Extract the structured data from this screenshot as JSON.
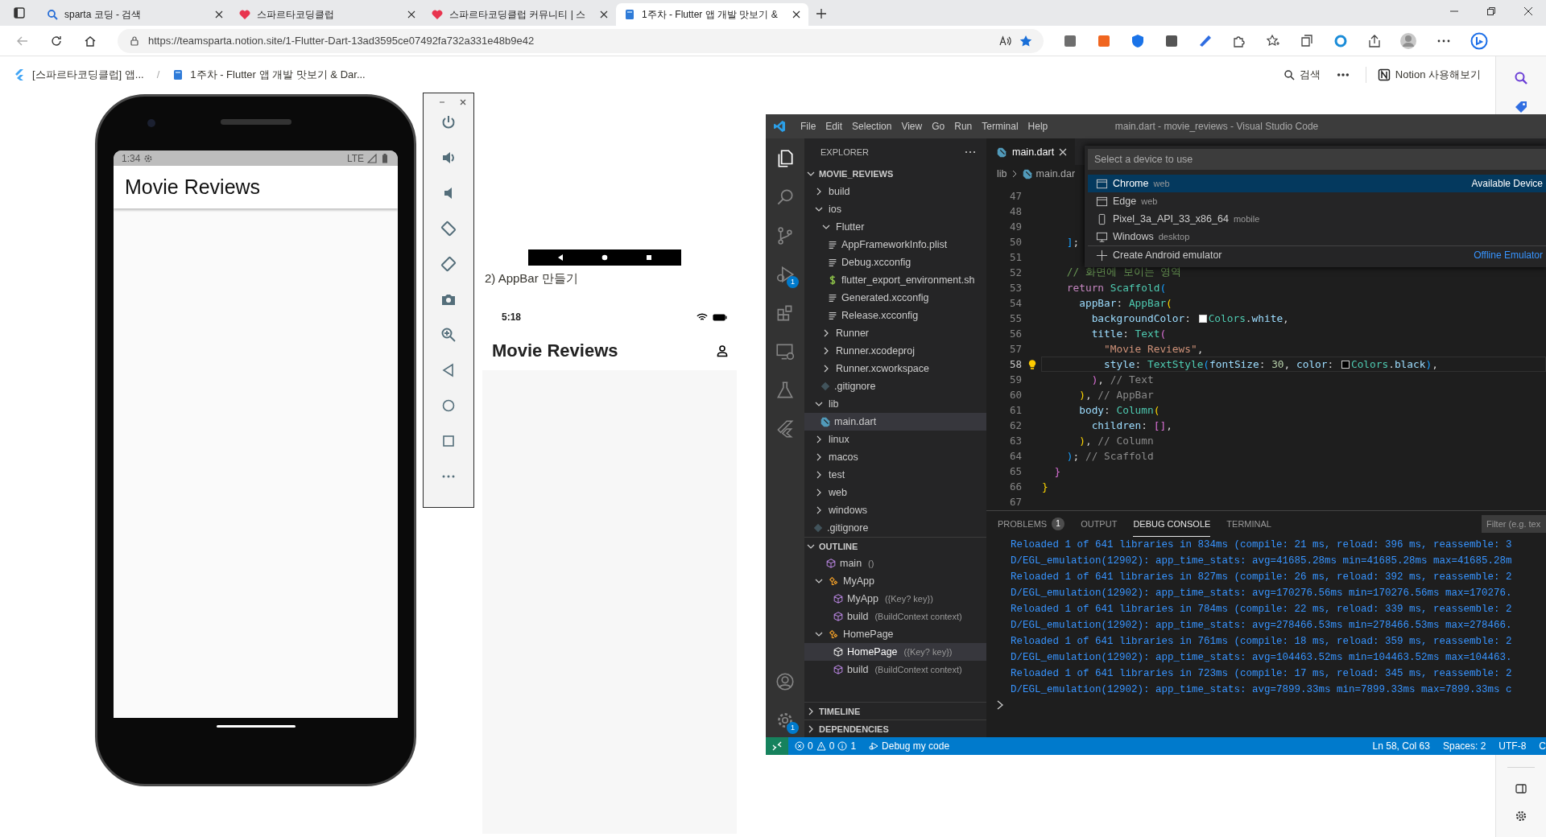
{
  "browser": {
    "tabs": [
      {
        "title": "sparta 코딩 - 검색",
        "selected": false
      },
      {
        "title": "스파르타코딩클럽",
        "selected": false
      },
      {
        "title": "스파르타코딩클럽 커뮤니티 | 스",
        "selected": false
      },
      {
        "title": "1주차 - Flutter 앱 개발 맛보기 &",
        "selected": true
      }
    ],
    "address": "https://teamsparta.notion.site/1-Flutter-Dart-13ad3595ce07492fa732a331e48b9e42"
  },
  "notion": {
    "breadcrumb": [
      {
        "text": "[스파르타코딩클럽] 앱...",
        "kind": "app"
      },
      {
        "text": "/",
        "kind": "sep"
      },
      {
        "text": "1주차 - Flutter 앱 개발 맛보기 & Dar...",
        "kind": "page"
      }
    ],
    "search": "검색",
    "try_button": "Notion 사용해보기"
  },
  "emulator": {
    "time": "1:34",
    "network": "LTE",
    "app_title": "Movie Reviews"
  },
  "note": "2) AppBar 만들기",
  "ios_shot": {
    "time": "5:18",
    "app_title": "Movie Reviews"
  },
  "vscode": {
    "menu": [
      "File",
      "Edit",
      "Selection",
      "View",
      "Go",
      "Run",
      "Terminal",
      "Help"
    ],
    "title": "main.dart - movie_reviews - Visual Studio Code",
    "badges": {
      "debug": "1",
      "settings": "1"
    },
    "explorer": {
      "header": "EXPLORER",
      "root": {
        "name": "MOVIE_REVIEWS",
        "expanded": true,
        "children": [
          {
            "name": "build",
            "kind": "folder",
            "expanded": false,
            "selected": false
          },
          {
            "name": "ios",
            "kind": "folder",
            "expanded": true,
            "selected": false,
            "children": [
              {
                "name": "Flutter",
                "kind": "folder",
                "expanded": true,
                "selected": false,
                "children": [
                  {
                    "name": "AppFrameworkInfo.plist",
                    "kind": "file",
                    "selected": false
                  },
                  {
                    "name": "Debug.xcconfig",
                    "kind": "file",
                    "selected": false
                  },
                  {
                    "name": "flutter_export_environment.sh",
                    "kind": "shell",
                    "selected": false
                  },
                  {
                    "name": "Generated.xcconfig",
                    "kind": "file",
                    "selected": false
                  },
                  {
                    "name": "Release.xcconfig",
                    "kind": "file",
                    "selected": false
                  }
                ]
              },
              {
                "name": "Runner",
                "kind": "folder",
                "expanded": false,
                "selected": false
              },
              {
                "name": "Runner.xcodeproj",
                "kind": "folder",
                "expanded": false,
                "selected": false
              },
              {
                "name": "Runner.xcworkspace",
                "kind": "folder",
                "expanded": false,
                "selected": false
              },
              {
                "name": ".gitignore",
                "kind": "git",
                "selected": false
              }
            ]
          },
          {
            "name": "lib",
            "kind": "folder",
            "expanded": true,
            "selected": false,
            "children": [
              {
                "name": "main.dart",
                "kind": "dart",
                "selected": true
              }
            ]
          },
          {
            "name": "linux",
            "kind": "folder",
            "expanded": false,
            "selected": false
          },
          {
            "name": "macos",
            "kind": "folder",
            "expanded": false,
            "selected": false
          },
          {
            "name": "test",
            "kind": "folder",
            "expanded": false,
            "selected": false
          },
          {
            "name": "web",
            "kind": "folder",
            "expanded": false,
            "selected": false
          },
          {
            "name": "windows",
            "kind": "folder",
            "expanded": false,
            "selected": false
          },
          {
            "name": ".gitignore",
            "kind": "git",
            "selected": false
          }
        ]
      }
    },
    "outline": {
      "title": "OUTLINE",
      "expanded": true,
      "children": [
        {
          "name": "main",
          "detail": "()",
          "kind": "method",
          "selected": false
        },
        {
          "name": "MyApp",
          "kind": "class",
          "expanded": true,
          "selected": false,
          "children": [
            {
              "name": "MyApp",
              "detail": "({Key? key})",
              "kind": "method",
              "selected": false
            },
            {
              "name": "build",
              "detail": "(BuildContext context)",
              "kind": "method",
              "selected": false
            }
          ]
        },
        {
          "name": "HomePage",
          "kind": "class",
          "expanded": true,
          "selected": false,
          "children": [
            {
              "name": "HomePage",
              "detail": "({Key? key})",
              "kind": "method",
              "selected": true
            },
            {
              "name": "build",
              "detail": "(BuildContext context)",
              "kind": "method",
              "selected": false
            }
          ]
        }
      ]
    },
    "timeline": {
      "title": "TIMELINE",
      "expanded": false
    },
    "dependencies": {
      "title": "DEPENDENCIES",
      "expanded": false
    },
    "editor": {
      "tab": "main.dart",
      "breadcrumb": [
        "lib",
        "main.dar"
      ],
      "lines": [
        {
          "number": "47",
          "current": false
        },
        {
          "number": "48",
          "current": false
        },
        {
          "number": "49",
          "current": false
        },
        {
          "number": "50",
          "current": false,
          "tokens": [
            {
              "text": "    ]",
              "kind": "b3"
            },
            {
              "text": ";",
              "kind": "punc"
            }
          ]
        },
        {
          "number": "51",
          "current": false
        },
        {
          "number": "52",
          "current": false,
          "tokens": [
            {
              "text": "    // 화면에 보이는 영역",
              "kind": "cmt"
            }
          ]
        },
        {
          "number": "53",
          "current": false,
          "tokens": [
            {
              "text": "    return",
              "kind": "kw"
            },
            {
              "text": " Scaffold",
              "kind": "cls"
            },
            {
              "text": "(",
              "kind": "b3"
            }
          ]
        },
        {
          "number": "54",
          "current": false,
          "tokens": [
            {
              "text": "      appBar",
              "kind": "prop"
            },
            {
              "text": ": ",
              "kind": "punc"
            },
            {
              "text": "AppBar",
              "kind": "cls"
            },
            {
              "text": "(",
              "kind": "b1"
            }
          ]
        },
        {
          "number": "55",
          "current": false,
          "tokens": [
            {
              "text": "        backgroundColor",
              "kind": "prop"
            },
            {
              "text": ": ",
              "kind": "punc"
            },
            {
              "kind": "swatch",
              "color": "#ffffff"
            },
            {
              "text": "Colors",
              "kind": "cls"
            },
            {
              "text": ".",
              "kind": "punc"
            },
            {
              "text": "white",
              "kind": "prop"
            },
            {
              "text": ",",
              "kind": "punc"
            }
          ]
        },
        {
          "number": "56",
          "current": false,
          "tokens": [
            {
              "text": "        title",
              "kind": "prop"
            },
            {
              "text": ": ",
              "kind": "punc"
            },
            {
              "text": "Text",
              "kind": "cls"
            },
            {
              "text": "(",
              "kind": "b2"
            }
          ]
        },
        {
          "number": "57",
          "current": false,
          "tokens": [
            {
              "text": "          \"Movie Reviews\"",
              "kind": "str"
            },
            {
              "text": ",",
              "kind": "punc"
            }
          ]
        },
        {
          "number": "58",
          "current": true,
          "tokens": [
            {
              "text": "          style",
              "kind": "prop"
            },
            {
              "text": ": ",
              "kind": "punc"
            },
            {
              "text": "TextStyle",
              "kind": "cls"
            },
            {
              "text": "(",
              "kind": "b3"
            },
            {
              "text": "fontSize",
              "kind": "prop"
            },
            {
              "text": ": ",
              "kind": "punc"
            },
            {
              "text": "30",
              "kind": "num"
            },
            {
              "text": ", ",
              "kind": "punc"
            },
            {
              "text": "color",
              "kind": "prop"
            },
            {
              "text": ": ",
              "kind": "punc"
            },
            {
              "kind": "swatch",
              "color": "#000000"
            },
            {
              "text": "Colors",
              "kind": "cls"
            },
            {
              "text": ".",
              "kind": "punc"
            },
            {
              "text": "black",
              "kind": "prop"
            },
            {
              "text": ")",
              "kind": "b3"
            },
            {
              "text": ",",
              "kind": "punc"
            }
          ]
        },
        {
          "number": "59",
          "current": false,
          "tokens": [
            {
              "text": "        )",
              "kind": "b2"
            },
            {
              "text": ", ",
              "kind": "punc"
            },
            {
              "text": "// Text",
              "kind": "hint"
            }
          ]
        },
        {
          "number": "60",
          "current": false,
          "tokens": [
            {
              "text": "      )",
              "kind": "b1"
            },
            {
              "text": ", ",
              "kind": "punc"
            },
            {
              "text": "// AppBar",
              "kind": "hint"
            }
          ]
        },
        {
          "number": "61",
          "current": false,
          "tokens": [
            {
              "text": "      body",
              "kind": "prop"
            },
            {
              "text": ": ",
              "kind": "punc"
            },
            {
              "text": "Column",
              "kind": "cls"
            },
            {
              "text": "(",
              "kind": "b1"
            }
          ]
        },
        {
          "number": "62",
          "current": false,
          "tokens": [
            {
              "text": "        children",
              "kind": "prop"
            },
            {
              "text": ": ",
              "kind": "punc"
            },
            {
              "text": "[]",
              "kind": "b2"
            },
            {
              "text": ",",
              "kind": "punc"
            }
          ]
        },
        {
          "number": "63",
          "current": false,
          "tokens": [
            {
              "text": "      )",
              "kind": "b1"
            },
            {
              "text": ", ",
              "kind": "punc"
            },
            {
              "text": "// Column",
              "kind": "hint"
            }
          ]
        },
        {
          "number": "64",
          "current": false,
          "tokens": [
            {
              "text": "    )",
              "kind": "b3"
            },
            {
              "text": "; ",
              "kind": "punc"
            },
            {
              "text": "// Scaffold",
              "kind": "hint"
            }
          ]
        },
        {
          "number": "65",
          "current": false,
          "tokens": [
            {
              "text": "  }",
              "kind": "b2"
            }
          ]
        },
        {
          "number": "66",
          "current": false,
          "tokens": [
            {
              "text": "}",
              "kind": "b1"
            }
          ]
        },
        {
          "number": "67",
          "current": false
        }
      ]
    },
    "quick_pick": {
      "placeholder": "Select a device to use",
      "items": [
        {
          "name": "Chrome",
          "detail": "web",
          "kind": "browser",
          "selected": true,
          "group": "Available Device"
        },
        {
          "name": "Edge",
          "detail": "web",
          "kind": "browser",
          "selected": false
        },
        {
          "name": "Pixel_3a_API_33_x86_64",
          "detail": "mobile",
          "kind": "phone",
          "selected": false
        },
        {
          "name": "Windows",
          "detail": "desktop",
          "kind": "desktop",
          "selected": false
        },
        {
          "name": "Create Android emulator",
          "kind": "add",
          "selected": false,
          "group": "Offline Emulator"
        }
      ]
    },
    "panel": {
      "tabs": [
        {
          "label": "PROBLEMS",
          "badge": "1",
          "selected": false
        },
        {
          "label": "OUTPUT",
          "selected": false
        },
        {
          "label": "DEBUG CONSOLE",
          "selected": true
        },
        {
          "label": "TERMINAL",
          "selected": false
        }
      ],
      "filter_placeholder": "Filter (e.g. tex",
      "lines": [
        "Reloaded 1 of 641 libraries in 834ms (compile: 21 ms, reload: 396 ms, reassemble: 3",
        "D/EGL_emulation(12902): app_time_stats: avg=41685.28ms min=41685.28ms max=41685.28m",
        "Reloaded 1 of 641 libraries in 827ms (compile: 26 ms, reload: 392 ms, reassemble: 2",
        "D/EGL_emulation(12902): app_time_stats: avg=170276.56ms min=170276.56ms max=170276.",
        "Reloaded 1 of 641 libraries in 784ms (compile: 22 ms, reload: 339 ms, reassemble: 2",
        "D/EGL_emulation(12902): app_time_stats: avg=278466.53ms min=278466.53ms max=278466.",
        "Reloaded 1 of 641 libraries in 761ms (compile: 18 ms, reload: 359 ms, reassemble: 2",
        "D/EGL_emulation(12902): app_time_stats: avg=104463.52ms min=104463.52ms max=104463.",
        "Reloaded 1 of 641 libraries in 723ms (compile: 17 ms, reload: 345 ms, reassemble: 2",
        "D/EGL_emulation(12902): app_time_stats: avg=7899.33ms min=7899.33ms max=7899.33ms c"
      ]
    },
    "status": {
      "errors": "0",
      "warnings": "0",
      "infos": "1",
      "debug": "Debug my code",
      "position": "Ln 58, Col 63",
      "spaces": "Spaces: 2",
      "encoding": "UTF-8",
      "eol": "C"
    }
  }
}
